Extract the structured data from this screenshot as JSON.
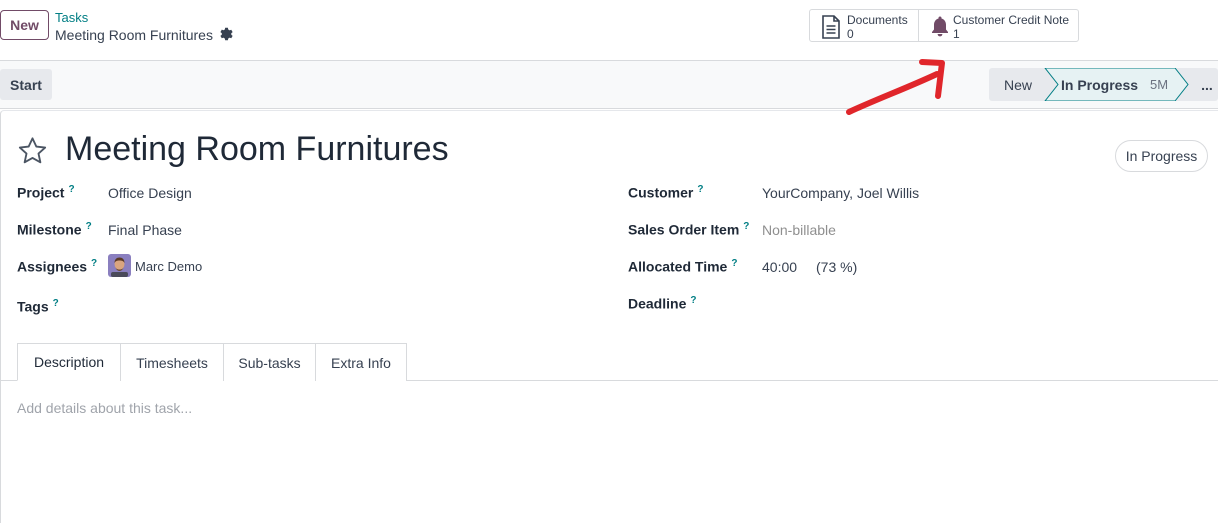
{
  "control_panel": {
    "new_button": "New",
    "breadcrumb_parent": "Tasks",
    "breadcrumb_current": "Meeting Room Furnitures"
  },
  "smart_buttons": {
    "documents": {
      "label": "Documents",
      "value": "0",
      "icon": "document-icon"
    },
    "credit_note": {
      "label": "Customer Credit Note",
      "value": "1",
      "icon": "bell-icon"
    }
  },
  "statusbar": {
    "start_button": "Start",
    "stages": [
      {
        "label": "New"
      },
      {
        "label": "In Progress",
        "duration": "5M",
        "active": true
      },
      {
        "label": "..."
      }
    ]
  },
  "form": {
    "title": "Meeting Room Furnitures",
    "state": "In Progress",
    "left_fields": [
      {
        "label": "Project",
        "value": "Office Design"
      },
      {
        "label": "Milestone",
        "value": "Final Phase"
      },
      {
        "label": "Assignees",
        "value": "Marc Demo"
      },
      {
        "label": "Tags",
        "value": ""
      }
    ],
    "right_fields": [
      {
        "label": "Customer",
        "value": "YourCompany, Joel Willis"
      },
      {
        "label": "Sales Order Item",
        "value": "Non-billable"
      },
      {
        "label": "Allocated Time",
        "value": "40:00",
        "extra": "(73 %)"
      },
      {
        "label": "Deadline",
        "value": ""
      }
    ],
    "help_marker": "?"
  },
  "tabs": [
    {
      "label": "Description",
      "active": true
    },
    {
      "label": "Timesheets"
    },
    {
      "label": "Sub-tasks"
    },
    {
      "label": "Extra Info"
    }
  ],
  "description_placeholder": "Add details about this task...",
  "colors": {
    "brand": "#714b67",
    "link": "#017e84",
    "annotation_arrow": "#e0262b"
  }
}
